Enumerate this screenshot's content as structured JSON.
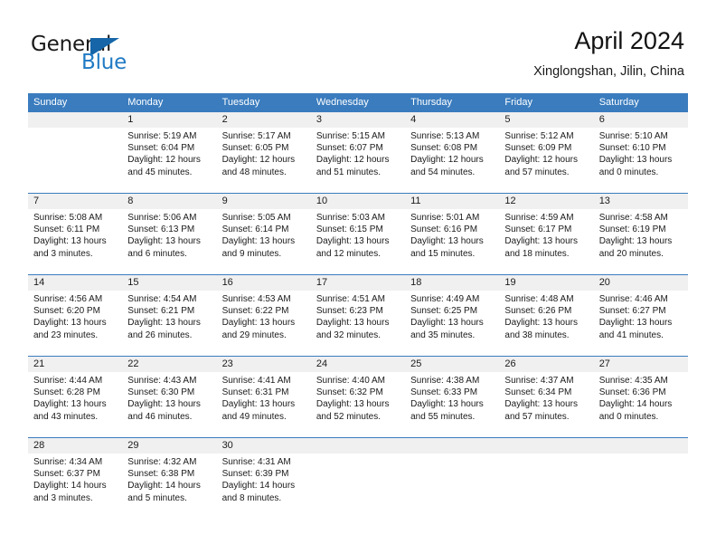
{
  "brand": {
    "word_one": "General",
    "word_two": "Blue",
    "triangle_icon": "blue-triangle-logo-icon"
  },
  "header": {
    "title": "April 2024",
    "subtitle": "Xinglongshan, Jilin, China"
  },
  "colors": {
    "header_blue": "#3a7cbe",
    "brand_blue": "#1f7ac4",
    "triangle_blue": "#1565a8",
    "number_band_gray": "#f0f0f0",
    "text": "#1a1a1a"
  },
  "weekdays": [
    "Sunday",
    "Monday",
    "Tuesday",
    "Wednesday",
    "Thursday",
    "Friday",
    "Saturday"
  ],
  "weeks": [
    {
      "days": [
        {
          "date": "",
          "lines": []
        },
        {
          "date": "1",
          "lines": [
            "Sunrise: 5:19 AM",
            "Sunset: 6:04 PM",
            "Daylight: 12 hours",
            "and 45 minutes."
          ]
        },
        {
          "date": "2",
          "lines": [
            "Sunrise: 5:17 AM",
            "Sunset: 6:05 PM",
            "Daylight: 12 hours",
            "and 48 minutes."
          ]
        },
        {
          "date": "3",
          "lines": [
            "Sunrise: 5:15 AM",
            "Sunset: 6:07 PM",
            "Daylight: 12 hours",
            "and 51 minutes."
          ]
        },
        {
          "date": "4",
          "lines": [
            "Sunrise: 5:13 AM",
            "Sunset: 6:08 PM",
            "Daylight: 12 hours",
            "and 54 minutes."
          ]
        },
        {
          "date": "5",
          "lines": [
            "Sunrise: 5:12 AM",
            "Sunset: 6:09 PM",
            "Daylight: 12 hours",
            "and 57 minutes."
          ]
        },
        {
          "date": "6",
          "lines": [
            "Sunrise: 5:10 AM",
            "Sunset: 6:10 PM",
            "Daylight: 13 hours",
            "and 0 minutes."
          ]
        }
      ]
    },
    {
      "days": [
        {
          "date": "7",
          "lines": [
            "Sunrise: 5:08 AM",
            "Sunset: 6:11 PM",
            "Daylight: 13 hours",
            "and 3 minutes."
          ]
        },
        {
          "date": "8",
          "lines": [
            "Sunrise: 5:06 AM",
            "Sunset: 6:13 PM",
            "Daylight: 13 hours",
            "and 6 minutes."
          ]
        },
        {
          "date": "9",
          "lines": [
            "Sunrise: 5:05 AM",
            "Sunset: 6:14 PM",
            "Daylight: 13 hours",
            "and 9 minutes."
          ]
        },
        {
          "date": "10",
          "lines": [
            "Sunrise: 5:03 AM",
            "Sunset: 6:15 PM",
            "Daylight: 13 hours",
            "and 12 minutes."
          ]
        },
        {
          "date": "11",
          "lines": [
            "Sunrise: 5:01 AM",
            "Sunset: 6:16 PM",
            "Daylight: 13 hours",
            "and 15 minutes."
          ]
        },
        {
          "date": "12",
          "lines": [
            "Sunrise: 4:59 AM",
            "Sunset: 6:17 PM",
            "Daylight: 13 hours",
            "and 18 minutes."
          ]
        },
        {
          "date": "13",
          "lines": [
            "Sunrise: 4:58 AM",
            "Sunset: 6:19 PM",
            "Daylight: 13 hours",
            "and 20 minutes."
          ]
        }
      ]
    },
    {
      "days": [
        {
          "date": "14",
          "lines": [
            "Sunrise: 4:56 AM",
            "Sunset: 6:20 PM",
            "Daylight: 13 hours",
            "and 23 minutes."
          ]
        },
        {
          "date": "15",
          "lines": [
            "Sunrise: 4:54 AM",
            "Sunset: 6:21 PM",
            "Daylight: 13 hours",
            "and 26 minutes."
          ]
        },
        {
          "date": "16",
          "lines": [
            "Sunrise: 4:53 AM",
            "Sunset: 6:22 PM",
            "Daylight: 13 hours",
            "and 29 minutes."
          ]
        },
        {
          "date": "17",
          "lines": [
            "Sunrise: 4:51 AM",
            "Sunset: 6:23 PM",
            "Daylight: 13 hours",
            "and 32 minutes."
          ]
        },
        {
          "date": "18",
          "lines": [
            "Sunrise: 4:49 AM",
            "Sunset: 6:25 PM",
            "Daylight: 13 hours",
            "and 35 minutes."
          ]
        },
        {
          "date": "19",
          "lines": [
            "Sunrise: 4:48 AM",
            "Sunset: 6:26 PM",
            "Daylight: 13 hours",
            "and 38 minutes."
          ]
        },
        {
          "date": "20",
          "lines": [
            "Sunrise: 4:46 AM",
            "Sunset: 6:27 PM",
            "Daylight: 13 hours",
            "and 41 minutes."
          ]
        }
      ]
    },
    {
      "days": [
        {
          "date": "21",
          "lines": [
            "Sunrise: 4:44 AM",
            "Sunset: 6:28 PM",
            "Daylight: 13 hours",
            "and 43 minutes."
          ]
        },
        {
          "date": "22",
          "lines": [
            "Sunrise: 4:43 AM",
            "Sunset: 6:30 PM",
            "Daylight: 13 hours",
            "and 46 minutes."
          ]
        },
        {
          "date": "23",
          "lines": [
            "Sunrise: 4:41 AM",
            "Sunset: 6:31 PM",
            "Daylight: 13 hours",
            "and 49 minutes."
          ]
        },
        {
          "date": "24",
          "lines": [
            "Sunrise: 4:40 AM",
            "Sunset: 6:32 PM",
            "Daylight: 13 hours",
            "and 52 minutes."
          ]
        },
        {
          "date": "25",
          "lines": [
            "Sunrise: 4:38 AM",
            "Sunset: 6:33 PM",
            "Daylight: 13 hours",
            "and 55 minutes."
          ]
        },
        {
          "date": "26",
          "lines": [
            "Sunrise: 4:37 AM",
            "Sunset: 6:34 PM",
            "Daylight: 13 hours",
            "and 57 minutes."
          ]
        },
        {
          "date": "27",
          "lines": [
            "Sunrise: 4:35 AM",
            "Sunset: 6:36 PM",
            "Daylight: 14 hours",
            "and 0 minutes."
          ]
        }
      ]
    },
    {
      "days": [
        {
          "date": "28",
          "lines": [
            "Sunrise: 4:34 AM",
            "Sunset: 6:37 PM",
            "Daylight: 14 hours",
            "and 3 minutes."
          ]
        },
        {
          "date": "29",
          "lines": [
            "Sunrise: 4:32 AM",
            "Sunset: 6:38 PM",
            "Daylight: 14 hours",
            "and 5 minutes."
          ]
        },
        {
          "date": "30",
          "lines": [
            "Sunrise: 4:31 AM",
            "Sunset: 6:39 PM",
            "Daylight: 14 hours",
            "and 8 minutes."
          ]
        },
        {
          "date": "",
          "lines": []
        },
        {
          "date": "",
          "lines": []
        },
        {
          "date": "",
          "lines": []
        },
        {
          "date": "",
          "lines": []
        }
      ]
    }
  ]
}
